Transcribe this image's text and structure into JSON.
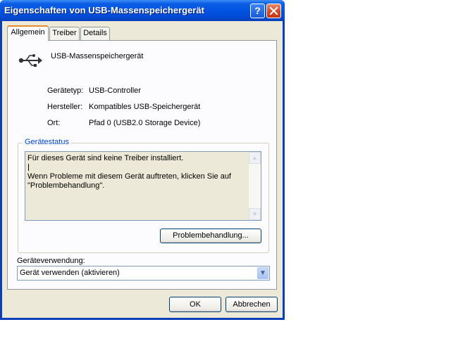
{
  "window": {
    "title": "Eigenschaften von USB-Massenspeichergerät",
    "help_label": "?",
    "close_label": "✕"
  },
  "tabs": [
    {
      "label": "Allgemein",
      "active": true
    },
    {
      "label": "Treiber",
      "active": false
    },
    {
      "label": "Details",
      "active": false
    }
  ],
  "device": {
    "icon": "usb-icon",
    "name": "USB-Massenspeichergerät",
    "props": [
      {
        "label": "Gerätetyp:",
        "value": "USB-Controller"
      },
      {
        "label": "Hersteller:",
        "value": "Kompatibles USB-Speichergerät"
      },
      {
        "label": "Ort:",
        "value": "Pfad 0 (USB2.0 Storage Device)"
      }
    ]
  },
  "status": {
    "legend": "Gerätestatus",
    "lines": [
      "Für dieses Gerät sind keine Treiber installiert.",
      "Wenn Probleme mit diesem Gerät auftreten, klicken Sie auf",
      "\"Problembehandlung\"."
    ],
    "troubleshoot_label": "Problembehandlung..."
  },
  "usage": {
    "label": "Geräteverwendung:",
    "selected": "Gerät verwenden (aktivieren)"
  },
  "buttons": {
    "ok": "OK",
    "cancel": "Abbrechen"
  },
  "colors": {
    "titlebar": "#0054e3",
    "client": "#ece9d8",
    "legend": "#0046d5"
  }
}
